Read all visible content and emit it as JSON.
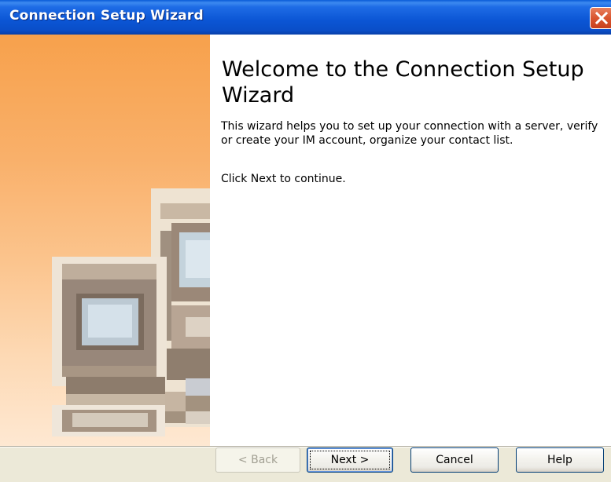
{
  "window": {
    "title": "Connection Setup Wizard"
  },
  "icons": {
    "close": "close-icon",
    "illustration": "network-computers-illustration"
  },
  "content": {
    "heading": "Welcome to the Connection Setup Wizard",
    "description": "This wizard helps you to set up your connection with a server, verify or create your IM account, organize your contact list.",
    "continue_text": "Click Next to continue."
  },
  "buttons": {
    "back": "< Back",
    "next": "Next >",
    "cancel": "Cancel",
    "help": "Help"
  },
  "colors": {
    "titlebar": "#0a55d4",
    "side_panel": "#f7a14c",
    "close_button": "#d9552f",
    "dialog_bg": "#ece9d8"
  }
}
